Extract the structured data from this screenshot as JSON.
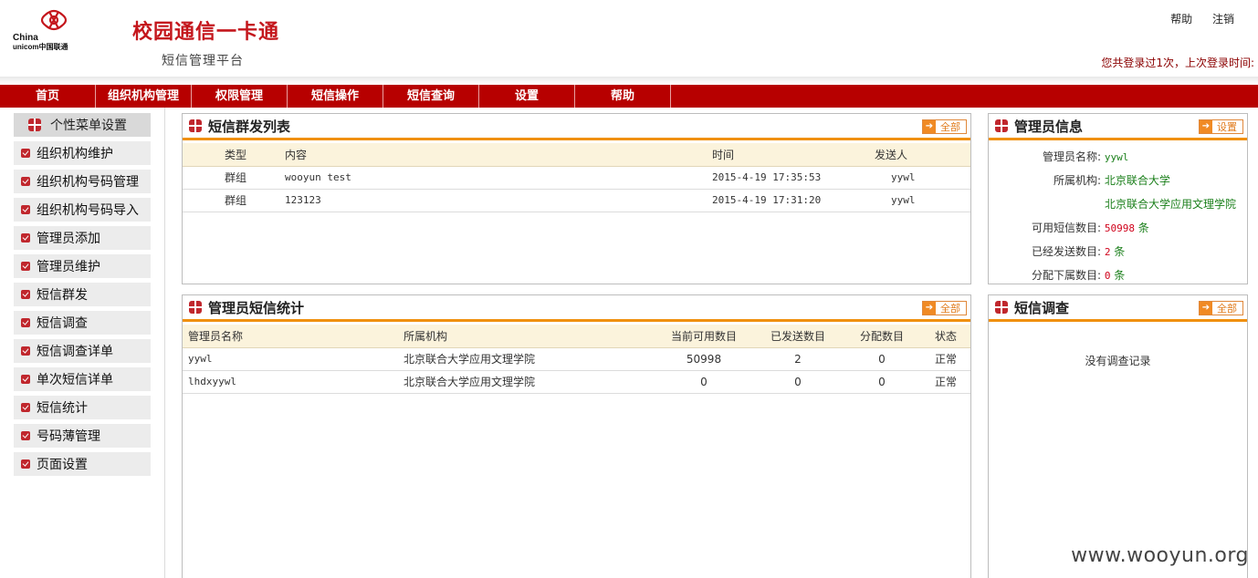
{
  "header": {
    "logo_line1": "China",
    "logo_line2": "unicom中国联通",
    "title": "校园通信一卡通",
    "subtitle": "短信管理平台",
    "help_link": "帮助",
    "logout_link": "注销",
    "login_info": "您共登录过1次，上次登录时间:"
  },
  "nav": {
    "items": [
      "首页",
      "组织机构管理",
      "权限管理",
      "短信操作",
      "短信查询",
      "设置",
      "帮助"
    ]
  },
  "sidebar": {
    "heading": "个性菜单设置",
    "items": [
      "组织机构维护",
      "组织机构号码管理",
      "组织机构号码导入",
      "管理员添加",
      "管理员维护",
      "短信群发",
      "短信调查",
      "短信调查详单",
      "单次短信详单",
      "短信统计",
      "号码薄管理",
      "页面设置"
    ]
  },
  "sms_list": {
    "title": "短信群发列表",
    "more_label": "全部",
    "columns": [
      "类型",
      "内容",
      "时间",
      "发送人"
    ],
    "rows": [
      {
        "type": "群组",
        "content": "wooyun test",
        "time": "2015-4-19 17:35:53",
        "sender": "yywl"
      },
      {
        "type": "群组",
        "content": "123123",
        "time": "2015-4-19 17:31:20",
        "sender": "yywl"
      }
    ]
  },
  "admin_stats": {
    "title": "管理员短信统计",
    "more_label": "全部",
    "columns": [
      "管理员名称",
      "所属机构",
      "当前可用数目",
      "已发送数目",
      "分配数目",
      "状态"
    ],
    "rows": [
      {
        "name": "yywl",
        "org": "北京联合大学应用文理学院",
        "available": "50998",
        "sent": "2",
        "assigned": "0",
        "status": "正常"
      },
      {
        "name": "lhdxyywl",
        "org": "北京联合大学应用文理学院",
        "available": "0",
        "sent": "0",
        "assigned": "0",
        "status": "正常"
      }
    ]
  },
  "admin_info": {
    "title": "管理员信息",
    "settings_label": "设置",
    "name_label": "管理员名称:",
    "name_value": "yywl",
    "org_label": "所属机构:",
    "org_value1": "北京联合大学",
    "org_value2": "北京联合大学应用文理学院",
    "available_label": "可用短信数目:",
    "available_value": "50998",
    "sent_label": "已经发送数目:",
    "sent_value": "2",
    "assigned_label": "分配下属数目:",
    "assigned_value": "0",
    "unit": "条"
  },
  "survey": {
    "title": "短信调查",
    "more_label": "全部",
    "empty_text": "没有调查记录"
  },
  "watermark": "www.wooyun.org",
  "colors": {
    "brand_red": "#b70000",
    "accent_orange": "#f0900e"
  }
}
